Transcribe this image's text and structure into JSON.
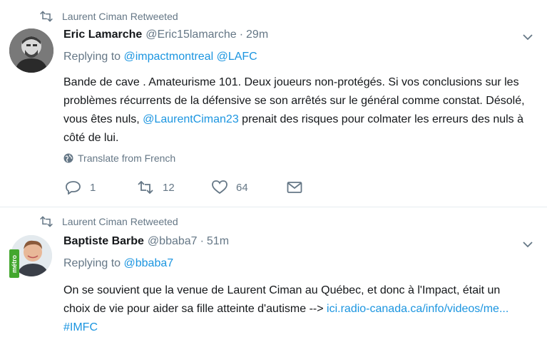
{
  "tweets": [
    {
      "retweet_context": "Laurent Ciman Retweeted",
      "name": "Eric Lamarche",
      "handle": "@Eric15lamarche",
      "separator": "·",
      "time": "29m",
      "replying_prefix": "Replying to",
      "replying_to": [
        "@impactmontreal",
        "@LAFC"
      ],
      "text_before_mention": "Bande de cave . Amateurisme 101.  Deux joueurs non-protégés. Si vos conclusions sur les problèmes récurrents de la défensive se son arrêtés sur le général comme constat. Désolé, vous êtes nuls, ",
      "mention": "@LaurentCiman23",
      "text_after_mention": " prenait des risques pour colmater les erreurs des nuls à côté de lui.",
      "translate_label": "Translate from French",
      "replies": "1",
      "retweets": "12",
      "likes": "64"
    },
    {
      "retweet_context": "Laurent Ciman Retweeted",
      "name": "Baptiste Barbe",
      "handle": "@bbaba7",
      "separator": "·",
      "time": "51m",
      "replying_prefix": "Replying to",
      "replying_to": [
        "@bbaba7"
      ],
      "text": "On se souvient que la venue de Laurent Ciman au Québec, et donc à l'Impact, était  un choix de vie pour aider sa fille atteinte d'autisme --> ",
      "link": "ici.radio-canada.ca/info/videos/me...",
      "hashtag": "#IMFC",
      "avatar_badge": "métro"
    }
  ],
  "colors": {
    "link": "#1b95e0",
    "secondary_text": "#657786",
    "primary_text": "#14171a",
    "divider": "#e6ecf0"
  },
  "icons": {
    "retweet_context": "retweet-icon",
    "caret": "chevron-down-icon",
    "translate": "globe-icon",
    "reply": "reply-icon",
    "retweet": "retweet-icon",
    "like": "heart-icon",
    "message": "envelope-icon"
  }
}
